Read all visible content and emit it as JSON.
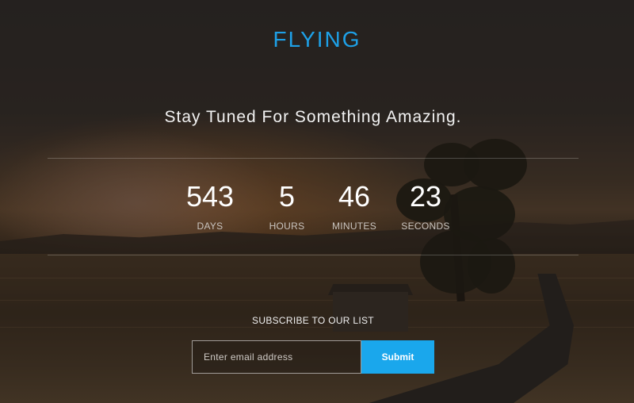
{
  "brand": {
    "title": "FLYING",
    "color": "#1ea0e6"
  },
  "tagline": "Stay Tuned For Something Amazing.",
  "countdown": {
    "days": {
      "value": "543",
      "label": "DAYS"
    },
    "hours": {
      "value": "5",
      "label": "HOURS"
    },
    "minutes": {
      "value": "46",
      "label": "MINUTES"
    },
    "seconds": {
      "value": "23",
      "label": "SECONDS"
    }
  },
  "subscribe": {
    "title": "SUBSCRIBE TO OUR LIST",
    "email_placeholder": "Enter email address",
    "email_value": "",
    "submit_label": "Submit",
    "accent": "#1aa7ec"
  }
}
